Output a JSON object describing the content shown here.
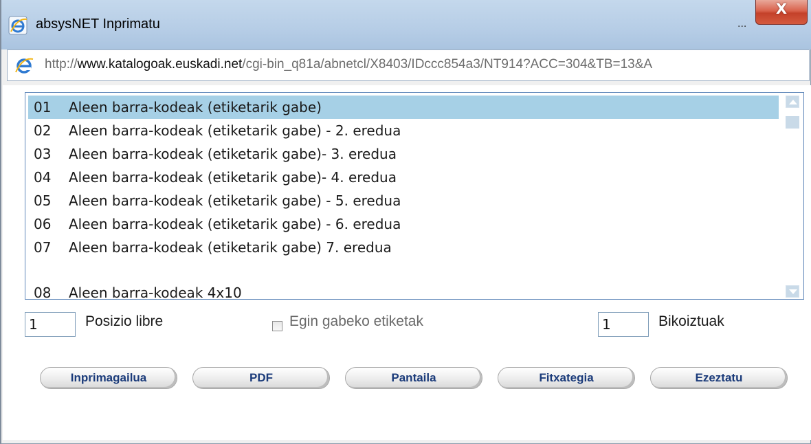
{
  "window": {
    "title": "absysNET Inprimatu",
    "title_overflow": "...",
    "close_label": "X"
  },
  "address": {
    "prefix": "http://",
    "domain": "www.katalogoak.euskadi.net",
    "path": "/cgi-bin_q81a/abnetcl/X8403/IDccc854a3/NT914?ACC=304&TB=13&A"
  },
  "list": {
    "items": [
      {
        "num": "01",
        "label": "Aleen barra-kodeak (etiketarik gabe)",
        "selected": true
      },
      {
        "num": "02",
        "label": "Aleen barra-kodeak (etiketarik gabe) - 2. eredua",
        "selected": false
      },
      {
        "num": "03",
        "label": "Aleen barra-kodeak (etiketarik gabe)- 3. eredua",
        "selected": false
      },
      {
        "num": "04",
        "label": "Aleen barra-kodeak (etiketarik gabe)- 4. eredua",
        "selected": false
      },
      {
        "num": "05",
        "label": "Aleen barra-kodeak (etiketarik gabe) - 5. eredua",
        "selected": false
      },
      {
        "num": "06",
        "label": "Aleen barra-kodeak (etiketarik gabe) - 6. eredua",
        "selected": false
      },
      {
        "num": "07",
        "label": "Aleen barra-kodeak (etiketarik gabe) 7. eredua",
        "selected": false
      },
      {
        "num": "08",
        "label": "Aleen barra-kodeak 4x10",
        "selected": false
      }
    ]
  },
  "options": {
    "position_value": "1",
    "position_label": "Posizio libre",
    "pending_label": "Egin gabeko etiketak",
    "pending_checked": false,
    "copies_value": "1",
    "copies_label": "Bikoiztuak"
  },
  "buttons": {
    "printer": "Inprimagailua",
    "pdf": "PDF",
    "screen": "Pantaila",
    "file": "Fitxategia",
    "cancel": "Ezeztatu"
  },
  "colors": {
    "selected_row": "#a6d0e6",
    "button_text": "#1b3b7a",
    "close_button": "#c4412a"
  }
}
